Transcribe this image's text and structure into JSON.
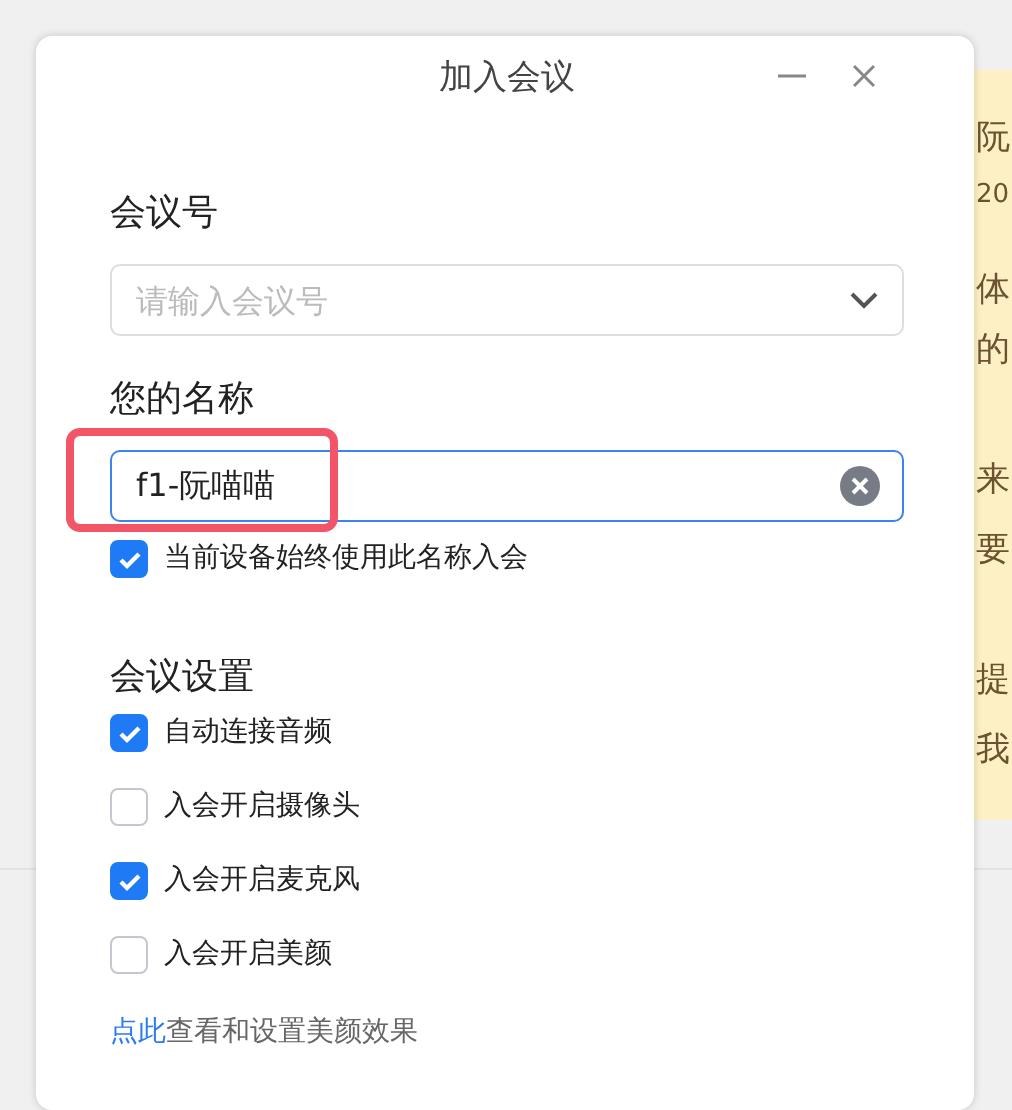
{
  "background_note": {
    "lines": [
      "阮",
      "20",
      "体",
      "的",
      "来",
      "要",
      "提",
      "我"
    ]
  },
  "dialog": {
    "title": "加入会议",
    "meeting_id": {
      "label": "会议号",
      "placeholder": "请输入会议号"
    },
    "name": {
      "label": "您的名称",
      "value": "f1-阮喵喵",
      "highlighted": true
    },
    "remember_name": {
      "label": "当前设备始终使用此名称入会",
      "checked": true
    },
    "settings": {
      "heading": "会议设置",
      "options": [
        {
          "label": "自动连接音频",
          "checked": true
        },
        {
          "label": "入会开启摄像头",
          "checked": false
        },
        {
          "label": "入会开启麦克风",
          "checked": true
        },
        {
          "label": "入会开启美颜",
          "checked": false
        }
      ]
    },
    "beauty_link": {
      "link": "点此",
      "text": "查看和设置美颜效果"
    }
  }
}
